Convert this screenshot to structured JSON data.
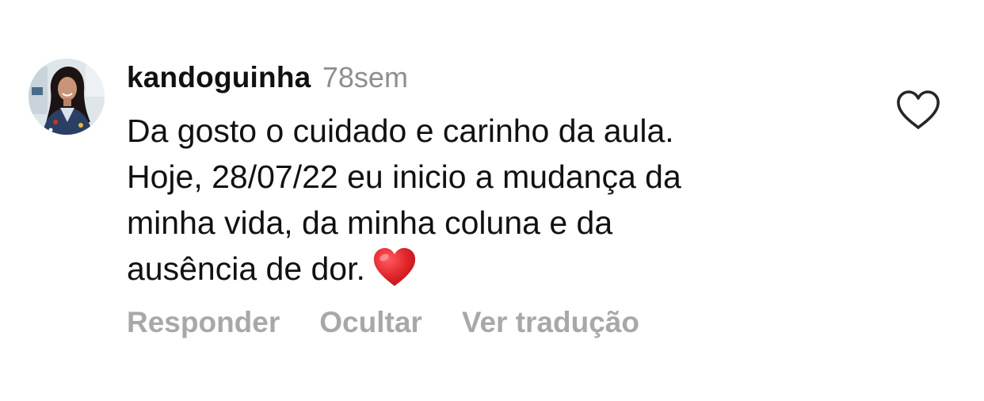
{
  "comment": {
    "username": "kandoguinha",
    "timestamp": "78sem",
    "text_lines": [
      "Da gosto o cuidado e carinho da aula.",
      "Hoje, 28/07/22 eu inicio a mudança da",
      "minha vida, da minha coluna e da",
      "ausência de dor."
    ],
    "emoji": "red-heart-emoji",
    "like_icon": "heart-outline-icon",
    "avatar": "profile-photo"
  },
  "actions": {
    "reply_label": "Responder",
    "hide_label": "Ocultar",
    "translate_label": "Ver tradução"
  },
  "colors": {
    "text": "#111111",
    "muted": "#8e8e8e",
    "action": "#a8a8a8",
    "heart_emoji": "#e0262b",
    "like_icon_stroke": "#262626"
  }
}
